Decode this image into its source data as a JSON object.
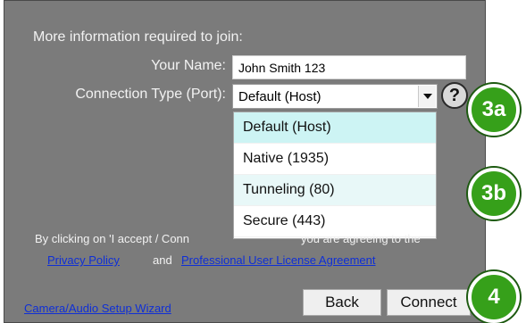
{
  "intro": "More information required to join:",
  "name": {
    "label": "Your Name:",
    "value": "John Smith 123"
  },
  "connection": {
    "label": "Connection Type (Port):",
    "selected": "Default (Host)",
    "options": [
      "Default (Host)",
      "Native (1935)",
      "Tunneling (80)",
      "Secure (443)"
    ]
  },
  "disclaimer": {
    "prefix": "By clicking on 'I accept / Conn",
    "suffix": "you are agreeing to the",
    "privacy_link": "Privacy Policy",
    "and": "and",
    "license_link": "Professional User License Agreement"
  },
  "wizard_link": "Camera/Audio Setup Wizard",
  "buttons": {
    "back": "Back",
    "connect": "Connect"
  },
  "callouts": {
    "a": "3a",
    "b": "3b",
    "c": "4"
  },
  "colors": {
    "panel": "#7b7b7b",
    "link": "#0f2fd6",
    "callout": "#36a01a",
    "highlight": "#cdf4f4"
  }
}
